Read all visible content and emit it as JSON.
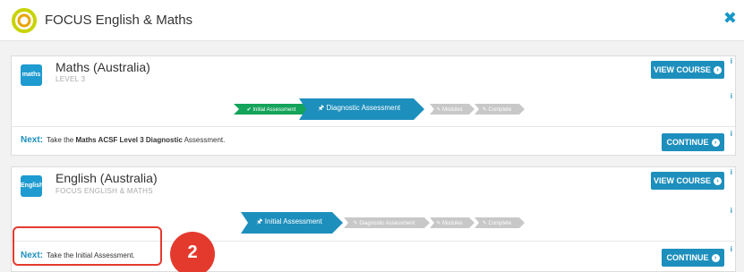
{
  "header": {
    "title": "FOCUS English & Maths",
    "close_icon": "✖"
  },
  "courses": [
    {
      "icon_text": "maths",
      "title": "Maths (Australia)",
      "subtitle": "LEVEL 3",
      "view_course": "VIEW COURSE",
      "continue": "CONTINUE",
      "next_label": "Next:",
      "next_text_pre": "Take the",
      "next_text_bold": "Maths ACSF Level 3 Diagnostic",
      "next_text_post": "Assessment.",
      "steps": [
        {
          "label": "✔ Initial Assessment",
          "status": "done"
        },
        {
          "label": "🖈 Diagnostic Assessment",
          "status": "current"
        },
        {
          "label": "✎ Modules",
          "status": "pending"
        },
        {
          "label": "✎ Complete",
          "status": "pending"
        }
      ]
    },
    {
      "icon_text": "English",
      "title": "English (Australia)",
      "subtitle": "FOCUS ENGLISH & MATHS",
      "view_course": "VIEW COURSE",
      "continue": "CONTINUE",
      "next_label": "Next:",
      "next_text_pre": "Take the Initial Assessment.",
      "steps": [
        {
          "label": "🖈 Initial Assessment",
          "status": "current"
        },
        {
          "label": "✎ Diagnostic Assessment",
          "status": "pending"
        },
        {
          "label": "✎ Modules",
          "status": "pending"
        },
        {
          "label": "✎ Complete",
          "status": "pending"
        }
      ]
    }
  ],
  "annotation": {
    "callout_number": "2"
  },
  "colors": {
    "accent": "#1d8fbd",
    "done": "#13a35a",
    "pending": "#c8c8c8",
    "highlight": "#e43a2e"
  }
}
